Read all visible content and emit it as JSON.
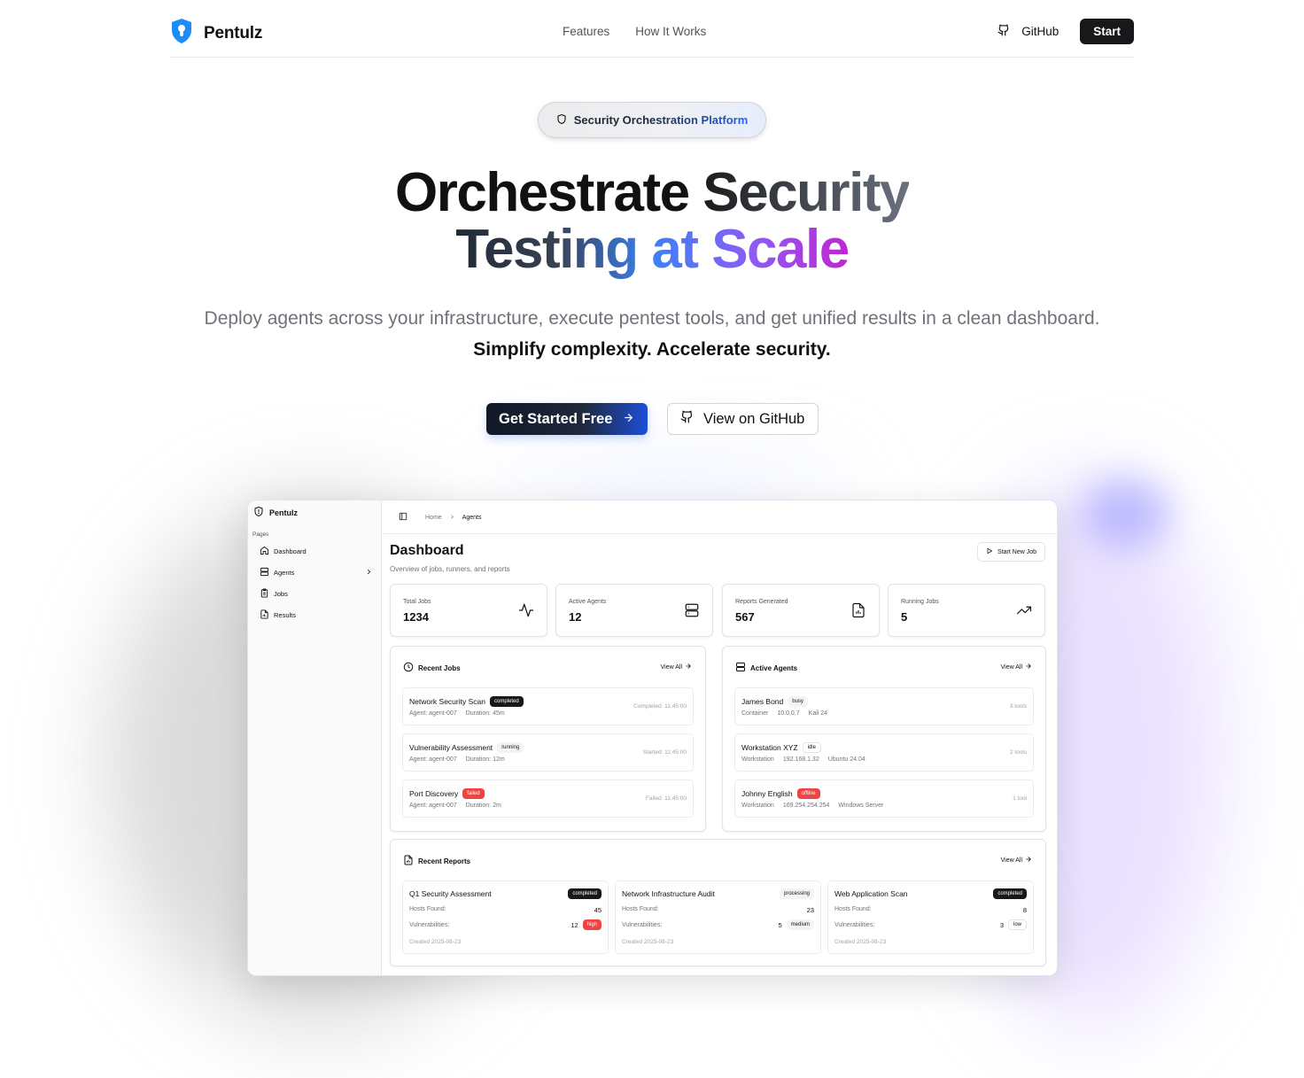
{
  "nav": {
    "brand": "Pentulz",
    "links": [
      "Features",
      "How It Works"
    ],
    "github_label": "GitHub",
    "start_label": "Start"
  },
  "hero": {
    "pill": "Security Orchestration Platform",
    "title_line1": [
      "Orchestrate ",
      "Security"
    ],
    "title_line2": [
      "Testing ",
      "at ",
      "Scale"
    ],
    "subtitle_plain": "Deploy agents across your infrastructure, execute pentest tools, and get unified results in a clean dashboard.",
    "subtitle_strong": "Simplify complexity. Accelerate security.",
    "cta_primary": "Get Started Free",
    "cta_secondary": "View on GitHub"
  },
  "app": {
    "brand": "Pentulz",
    "sidebar_section": "Pages",
    "sidebar_items": [
      {
        "label": "Dashboard",
        "icon": "home-icon"
      },
      {
        "label": "Agents",
        "icon": "server-icon"
      },
      {
        "label": "Jobs",
        "icon": "clipboard-icon"
      },
      {
        "label": "Results",
        "icon": "file-chart-icon"
      }
    ],
    "breadcrumb": [
      "Home",
      "Agents"
    ],
    "title": "Dashboard",
    "subtitle": "Overview of jobs, runners, and reports",
    "start_new_job": "Start New Job",
    "stats": [
      {
        "label": "Total Jobs",
        "value": "1234",
        "icon": "activity-icon"
      },
      {
        "label": "Active Agents",
        "value": "12",
        "icon": "server-icon"
      },
      {
        "label": "Reports Generated",
        "value": "567",
        "icon": "file-chart-icon"
      },
      {
        "label": "Running Jobs",
        "value": "5",
        "icon": "trending-up-icon"
      }
    ],
    "recent_jobs": {
      "title": "Recent Jobs",
      "view_all": "View All",
      "items": [
        {
          "name": "Network Security Scan",
          "status": "completed",
          "agent": "Agent: agent-007",
          "duration": "Duration: 45m",
          "time": "Completed: 11:45:00"
        },
        {
          "name": "Vulnerability Assessment",
          "status": "running",
          "agent": "Agent: agent-007",
          "duration": "Duration: 12m",
          "time": "Started: 11:45:00"
        },
        {
          "name": "Port Discovery",
          "status": "failed",
          "agent": "Agent: agent-007",
          "duration": "Duration: 2m",
          "time": "Failed: 11:45:00"
        }
      ]
    },
    "active_agents": {
      "title": "Active Agents",
      "view_all": "View All",
      "items": [
        {
          "name": "James Bond",
          "status": "busy",
          "type": "Container",
          "ip": "10.0.0.7",
          "os": "Kali 24",
          "tools": "3 tools"
        },
        {
          "name": "Workstation XYZ",
          "status": "idle",
          "type": "Workstation",
          "ip": "192.168.1.32",
          "os": "Ubuntu 24.04",
          "tools": "2 tools"
        },
        {
          "name": "Johnny English",
          "status": "offline",
          "type": "Workstation",
          "ip": "169.254.254.254",
          "os": "Windows Server",
          "tools": "1 tool"
        }
      ]
    },
    "recent_reports": {
      "title": "Recent Reports",
      "view_all": "View All",
      "hosts_label": "Hosts Found:",
      "vulns_label": "Vulnerabilities:",
      "items": [
        {
          "name": "Q1 Security Assessment",
          "status": "completed",
          "hosts": "45",
          "vulns": "12",
          "severity": "high",
          "created": "Created 2025-08-23"
        },
        {
          "name": "Network Infrastructure Audit",
          "status": "processing",
          "hosts": "23",
          "vulns": "5",
          "severity": "medium",
          "created": "Created 2025-08-23"
        },
        {
          "name": "Web Application Scan",
          "status": "completed",
          "hosts": "8",
          "vulns": "3",
          "severity": "low",
          "created": "Created 2025-08-23"
        }
      ]
    }
  },
  "colors": {
    "primary": "#18181b",
    "accent_blue": "#2563eb",
    "accent_purple": "#8b5cf6",
    "danger": "#ef4444",
    "logo_blue": "#1d8cf8"
  }
}
